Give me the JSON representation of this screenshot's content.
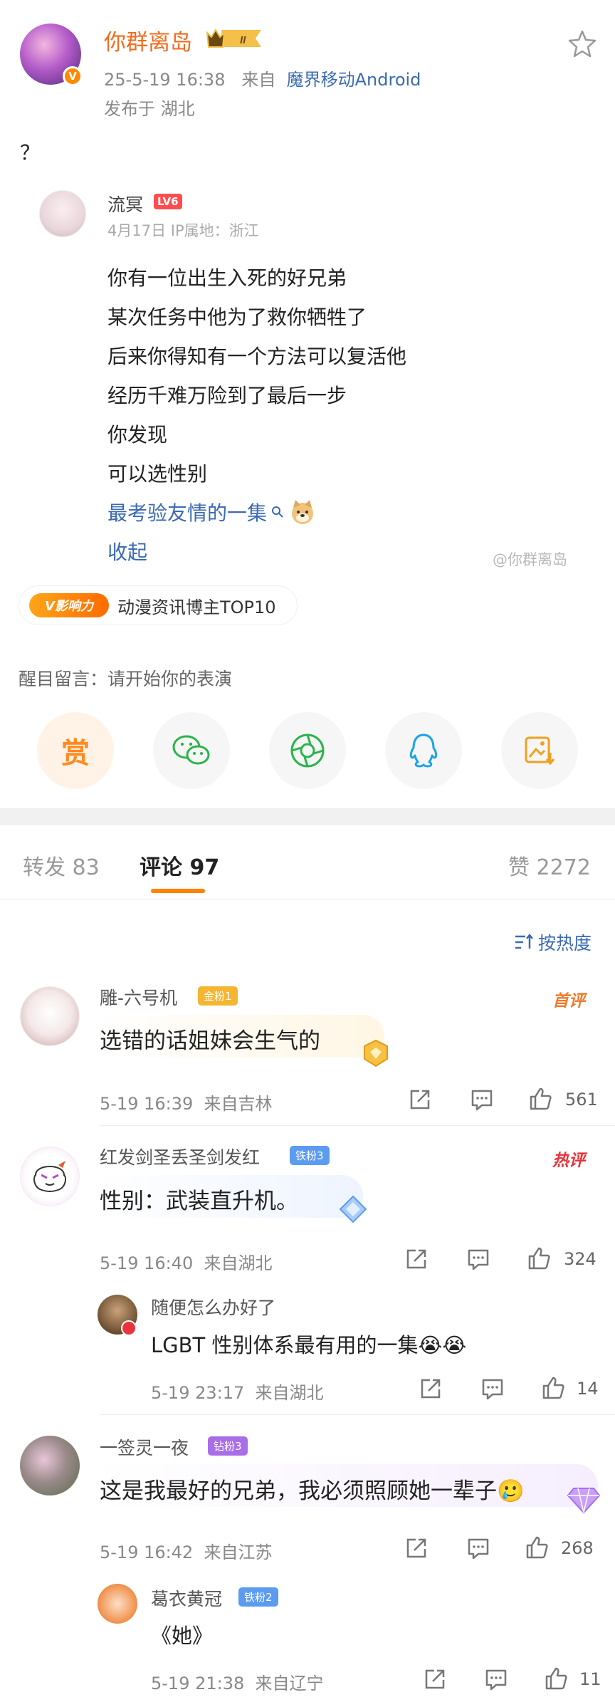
{
  "post": {
    "author": "你群离岛",
    "level_badge": "II",
    "time": "25-5-19 16:38",
    "from_prefix": "来自",
    "source": "魔界移动Android",
    "location": "发布于 湖北",
    "text": "？"
  },
  "quote": {
    "author": "流冥",
    "level": "LV6",
    "meta": "4月17日 IP属地：浙江",
    "lines": [
      "你有一位出生入死的好兄弟",
      "某次任务中他为了救你牺牲了",
      "后来你得知有一个方法可以复活他",
      "经历千难万险到了最后一步",
      "你发现",
      "可以选性别"
    ],
    "link_text": "最考验友情的一集",
    "fold": "收起",
    "watermark": "@你群离岛"
  },
  "influence": {
    "logo": "V影响力",
    "text": "动漫资讯博主TOP10"
  },
  "eye_message": "醒目留言：请开始你的表演",
  "share_icons": [
    "reward-icon",
    "wechat-icon",
    "moments-icon",
    "qq-icon",
    "save-image-icon"
  ],
  "share_reward_label": "赏",
  "tabs": {
    "repost": "转发 83",
    "comment": "评论 97",
    "like": "赞 2272"
  },
  "sort_label": "按热度",
  "comments": [
    {
      "name": "雕-六号机",
      "badge": "金粉1",
      "tag": "首评",
      "text": "选错的话姐妹会生气的",
      "time": "5-19 16:39",
      "from": "来自吉林",
      "likes": "561"
    },
    {
      "name": "红发剑圣丢圣剑发红",
      "badge": "铁粉3",
      "tag": "热评",
      "text": "性别：武装直升机。",
      "time": "5-19 16:40",
      "from": "来自湖北",
      "likes": "324",
      "reply": {
        "name": "随便怎么办好了",
        "text": "LGBT 性别体系最有用的一集😭😭",
        "time": "5-19 23:17",
        "from": "来自湖北",
        "likes": "14"
      }
    },
    {
      "name": "一签灵一夜",
      "badge": "钻粉3",
      "text": "这是我最好的兄弟，我必须照顾她一辈子🥲",
      "time": "5-19 16:42",
      "from": "来自江苏",
      "likes": "268",
      "reply": {
        "name": "葛衣黄冠",
        "badge": "铁粉2",
        "text": "《她》",
        "time": "5-19 21:38",
        "from": "来自辽宁",
        "likes": "11"
      }
    }
  ],
  "colors": {
    "accent_orange": "#ff8200",
    "link_blue": "#3a6ab4",
    "author_orange": "#f26b1d",
    "hot_red": "#e8333a"
  }
}
